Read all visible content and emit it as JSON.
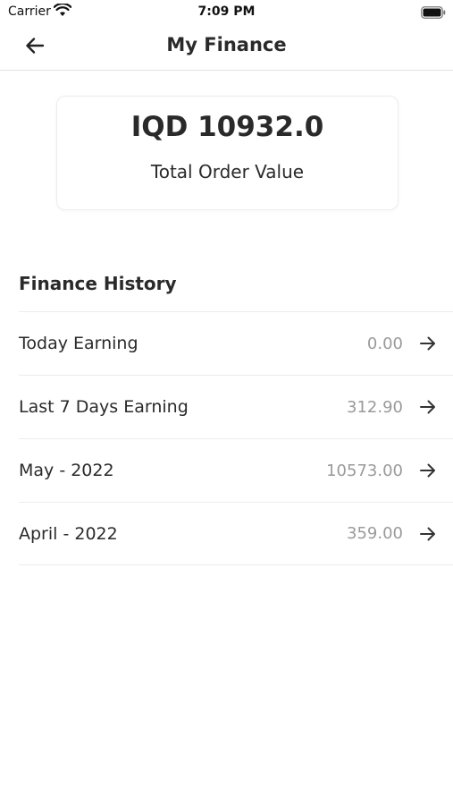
{
  "status_bar": {
    "carrier": "Carrier",
    "time": "7:09 PM"
  },
  "nav": {
    "title": "My Finance",
    "back_icon": "arrow-left-icon"
  },
  "summary": {
    "amount": "IQD 10932.0",
    "label": "Total Order Value"
  },
  "finance_history": {
    "title": "Finance History",
    "items": [
      {
        "label": "Today Earning",
        "amount": "0.00"
      },
      {
        "label": "Last 7 Days Earning",
        "amount": "312.90"
      },
      {
        "label": "May - 2022",
        "amount": "10573.00"
      },
      {
        "label": "April - 2022",
        "amount": "359.00"
      }
    ]
  },
  "colors": {
    "text_primary": "#2a2a2a",
    "text_secondary": "#9a9a9a",
    "divider": "#ececec"
  }
}
